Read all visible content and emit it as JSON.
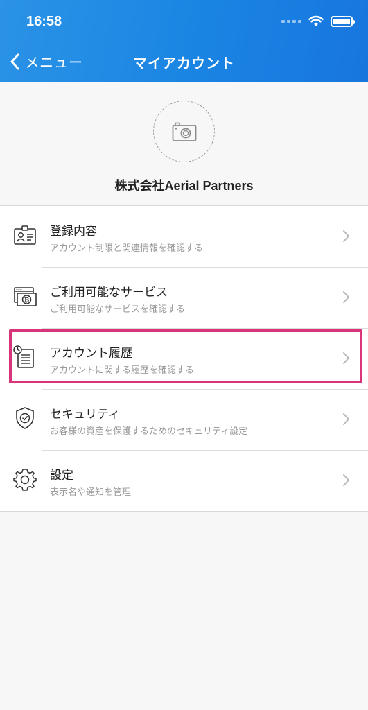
{
  "status_bar": {
    "time": "16:58"
  },
  "nav": {
    "back_label": "メニュー",
    "title": "マイアカウント"
  },
  "profile": {
    "company_name": "株式会社Aerial Partners"
  },
  "menu": {
    "items": [
      {
        "title": "登録内容",
        "subtitle": "アカウント制限と関連情報を確認する",
        "icon": "id-card-icon"
      },
      {
        "title": "ご利用可能なサービス",
        "subtitle": "ご利用可能なサービスを確認する",
        "icon": "bitcoin-browser-icon"
      },
      {
        "title": "アカウント履歴",
        "subtitle": "アカウントに関する履歴を確認する",
        "icon": "history-document-icon"
      },
      {
        "title": "セキュリティ",
        "subtitle": "お客様の資産を保護するためのセキュリティ設定",
        "icon": "shield-check-icon"
      },
      {
        "title": "設定",
        "subtitle": "表示名や通知を管理",
        "icon": "gear-icon"
      }
    ]
  },
  "colors": {
    "header_blue": "#1a84e3",
    "highlight": "#d8347a"
  }
}
